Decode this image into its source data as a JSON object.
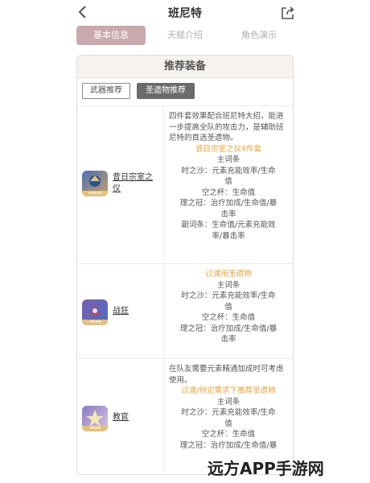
{
  "header": {
    "title": "班尼特",
    "back_icon": "chevron-left-icon",
    "share_icon": "share-icon"
  },
  "tabs": [
    {
      "label": "基本信息",
      "active": true
    },
    {
      "label": "天赋介绍",
      "active": false
    },
    {
      "label": "角色演示",
      "active": false
    }
  ],
  "card": {
    "title": "推荐装备",
    "filters": {
      "weapon": "武器推荐",
      "artifact": "圣遗物推荐"
    }
  },
  "artifacts": [
    {
      "name_line1": "昔日宗室之",
      "name_line2": "仪",
      "desc": "四件套效果配合班尼特大招，能进一步提高全队的攻击力，是辅助班尼特的首选圣遗物。",
      "note": "昔日宗室之仪4件套",
      "lines": [
        "主词条",
        "时之沙：元素充能效率/生命",
        "值",
        "空之杯：生命值",
        "理之冠：治疗加成/生命值/暴",
        "击率",
        "副词条：生命值/元素充能效",
        "率/暴击率"
      ]
    },
    {
      "name_line1": "战狂",
      "name_line2": "",
      "desc": "",
      "note": "过渡用圣遗物",
      "lines": [
        "主词条",
        "时之沙：元素充能效率/生命",
        "值",
        "空之杯：生命值",
        "理之冠：治疗加成/生命值/暴",
        "击率"
      ]
    },
    {
      "name_line1": "教官",
      "name_line2": "",
      "desc": "在队友需要元素精通加成时可考虑使用。",
      "note": "过渡/特定需求下推荐圣遗物",
      "lines": [
        "主词条",
        "时之沙：元素充能效率/生命",
        "值",
        "空之杯：生命值",
        "理之冠：治疗加成/生命值/暴"
      ]
    }
  ],
  "watermark": "远方APP手游网",
  "colors": {
    "tab_active": "#c9a8ae",
    "highlight": "#e8a33b",
    "filter_active": "#6b6b6b"
  }
}
